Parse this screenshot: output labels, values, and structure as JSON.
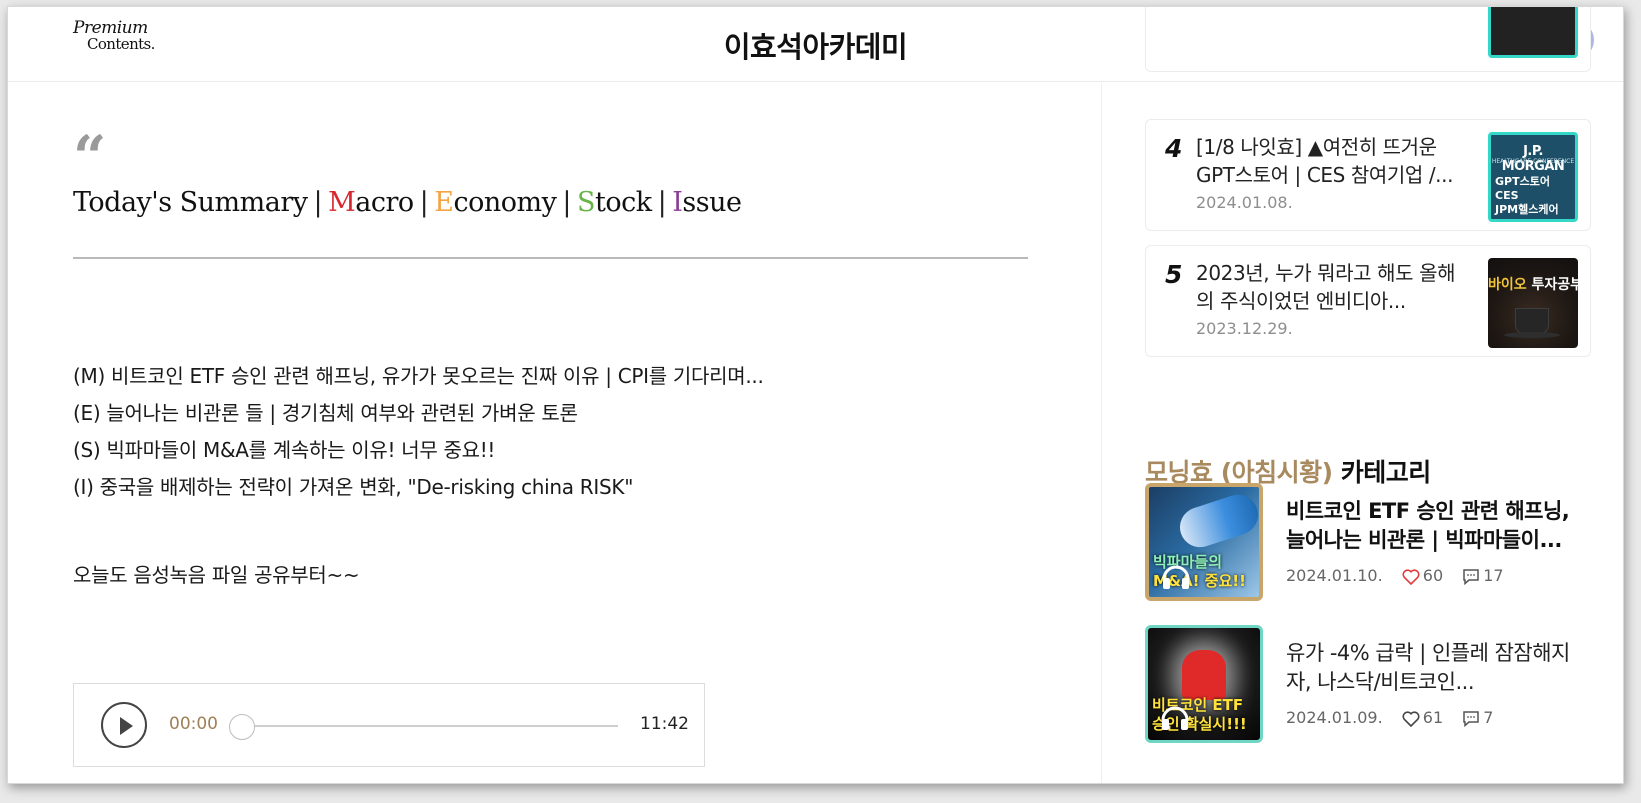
{
  "header": {
    "logo_line1": "Premium",
    "logo_line2": "Contents.",
    "site_title": "이효석아카데미",
    "search_label": "search",
    "avatar_label": "profile"
  },
  "summary": {
    "prefix": "Today's Summary",
    "separator": "|",
    "macro_initial": "M",
    "macro_rest": "acro",
    "economy_initial": "E",
    "economy_rest": "conomy",
    "stock_initial": "S",
    "stock_rest": "tock",
    "issue_initial": "I",
    "issue_rest": "ssue",
    "colors": {
      "macro": "#d8272e",
      "economy": "#f3a443",
      "stock": "#6ab34a",
      "issue": "#8e3c98"
    }
  },
  "topics": [
    "(M) 비트코인 ETF 승인 관련 해프닝, 유가가 못오르는 진짜 이유 | CPI를 기다리며...",
    "(E) 늘어나는 비관론 들 | 경기침체 여부와 관련된 가벼운 토론",
    "(S) 빅파마들이 M&A를 계속하는 이유! 너무 중요!!",
    "(I) 중국을 배제하는 전략이 가져온 변화, \"De-risking china RISK\""
  ],
  "share_note": "오늘도 음성녹음 파일 공유부터~~",
  "player": {
    "current_time": "00:00",
    "total_time": "11:42",
    "progress": 0.0
  },
  "popular": [
    {
      "rank": "4",
      "title": "[1/8 나잇효] ▲여전히 뜨거운 GPT스토어 | CES 참여기업 /...",
      "date": "2024.01.08.",
      "thumb": {
        "line1": "J.P. MORGAN",
        "line2": "HEALTHCARE CONFERENCE",
        "line3": "GPT스토어",
        "line4": "CES",
        "line5": "JPM헬스케어"
      }
    },
    {
      "rank": "5",
      "title": "2023년, 누가 뭐라고 해도 올해의 주식이었던 엔비디아...",
      "date": "2023.12.29.",
      "thumb": {
        "label_a": "바이오",
        "label_b": "투자공부"
      }
    }
  ],
  "category": {
    "accent": "모닝효 (아침시황)",
    "suffix": "카테고리",
    "accent_color": "#a98a5f"
  },
  "posts": [
    {
      "title": "비트코인 ETF 승인 관련 해프닝, 늘어나는 비관론 | 빅파마들이...",
      "date": "2024.01.10.",
      "likes": "60",
      "comments": "17",
      "thumb_text1": "빅파마들의",
      "thumb_text2": "M&A! 중요!!"
    },
    {
      "title": "유가 -4% 급락 | 인플레 잠잠해지자, 나스닥/비트코인...",
      "date": "2024.01.09.",
      "likes": "61",
      "comments": "7",
      "thumb_text1": "비트코인 ETF",
      "thumb_text2": "승인 확실시!!!"
    }
  ]
}
